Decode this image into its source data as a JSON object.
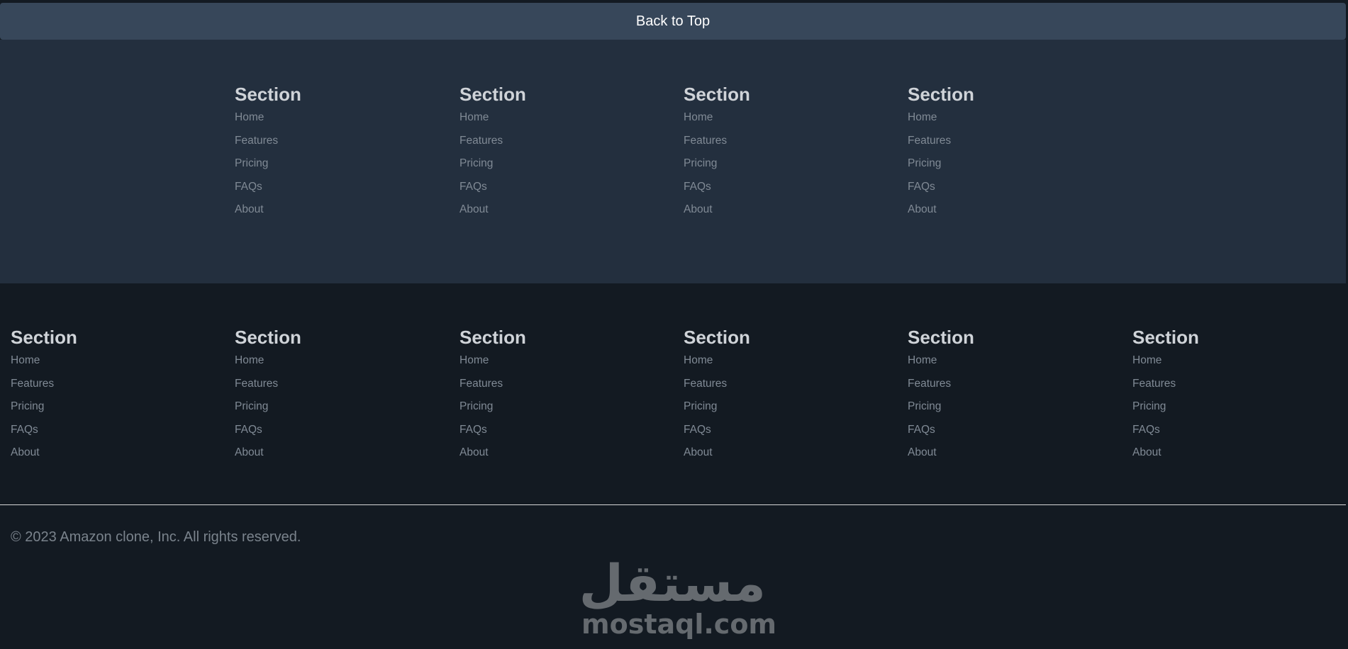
{
  "back_to_top": {
    "label": "Back to Top"
  },
  "upper_sections": [
    {
      "title": "Section",
      "links": [
        "Home",
        "Features",
        "Pricing",
        "FAQs",
        "About"
      ]
    },
    {
      "title": "Section",
      "links": [
        "Home",
        "Features",
        "Pricing",
        "FAQs",
        "About"
      ]
    },
    {
      "title": "Section",
      "links": [
        "Home",
        "Features",
        "Pricing",
        "FAQs",
        "About"
      ]
    },
    {
      "title": "Section",
      "links": [
        "Home",
        "Features",
        "Pricing",
        "FAQs",
        "About"
      ]
    }
  ],
  "lower_sections": [
    {
      "title": "Section",
      "links": [
        "Home",
        "Features",
        "Pricing",
        "FAQs",
        "About"
      ]
    },
    {
      "title": "Section",
      "links": [
        "Home",
        "Features",
        "Pricing",
        "FAQs",
        "About"
      ]
    },
    {
      "title": "Section",
      "links": [
        "Home",
        "Features",
        "Pricing",
        "FAQs",
        "About"
      ]
    },
    {
      "title": "Section",
      "links": [
        "Home",
        "Features",
        "Pricing",
        "FAQs",
        "About"
      ]
    },
    {
      "title": "Section",
      "links": [
        "Home",
        "Features",
        "Pricing",
        "FAQs",
        "About"
      ]
    },
    {
      "title": "Section",
      "links": [
        "Home",
        "Features",
        "Pricing",
        "FAQs",
        "About"
      ]
    }
  ],
  "footer": {
    "copyright": "© 2023 Amazon clone, Inc. All rights reserved."
  },
  "watermark": {
    "arabic": "مستقل",
    "latin": "mostaql.com"
  },
  "colors": {
    "back_to_top_bg": "#37475a",
    "upper_bg": "#232f3e",
    "lower_bg": "#131a22",
    "heading": "#cfd3d8",
    "link": "#808a95"
  }
}
